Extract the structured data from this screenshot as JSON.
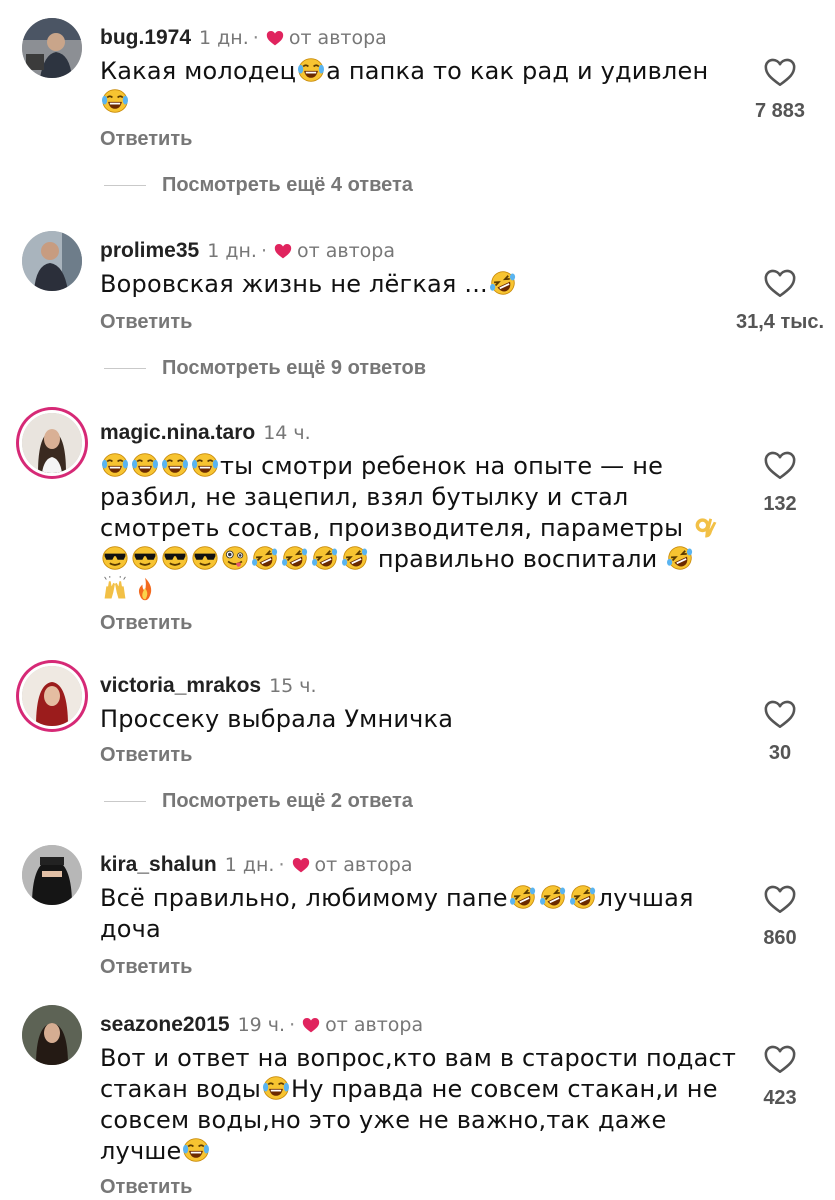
{
  "colors": {
    "heart_author": "#e0245e",
    "text_muted": "#777777",
    "story_ring": "#d62976"
  },
  "comments": [
    {
      "username": "bug.1974",
      "time": "1 дн.",
      "separator": "·",
      "author_liked": true,
      "author_label": "от автора",
      "text_parts": [
        "Какая молодец",
        "a папка то как рад и удивлен",
        ""
      ],
      "reply_label": "Ответить",
      "likes": "7 883",
      "more_replies": "Посмотреть ещё 4 ответа"
    },
    {
      "username": "prolime35",
      "time": "1 дн.",
      "separator": "·",
      "author_liked": true,
      "author_label": "от автора",
      "text_parts": [
        "Воровская жизнь не лёгкая ..."
      ],
      "reply_label": "Ответить",
      "likes": "31,4 тыс.",
      "more_replies": "Посмотреть ещё 9 ответов"
    },
    {
      "username": "magic.nina.taro",
      "time": "14 ч.",
      "text_parts": [
        "ты смотри ребенок на опыте — не разбил, не зацепил, взял бутылку и стал смотреть состав, производителя, параметры",
        "правильно воспитали"
      ],
      "reply_label": "Ответить",
      "likes": "132"
    },
    {
      "username": "victoria_mrakos",
      "time": "15 ч.",
      "text_parts": [
        "Проссеку выбрала Умничка"
      ],
      "reply_label": "Ответить",
      "likes": "30",
      "more_replies": "Посмотреть ещё 2 ответа"
    },
    {
      "username": "kira_shalun",
      "time": "1 дн.",
      "separator": "·",
      "author_liked": true,
      "author_label": "от автора",
      "text_parts": [
        "Всё правильно, любимому папе",
        "лучшая доча"
      ],
      "reply_label": "Ответить",
      "likes": "860"
    },
    {
      "username": "seazone2015",
      "time": "19 ч.",
      "separator": "·",
      "author_liked": true,
      "author_label": "от автора",
      "text_parts": [
        "Вот и ответ на вопрос,кто вам в старости подаст стакан воды",
        "Ну правда не совсем стакан,и не совсем воды,но это уже не важно,так даже лучше"
      ],
      "reply_label": "Ответить",
      "likes": "423"
    }
  ],
  "icons": {
    "like": "heart-outline-icon",
    "author_like": "heart-filled-icon",
    "emoji_laugh_tears": "laughing-tears-emoji",
    "emoji_rofl": "rolling-laughing-emoji",
    "emoji_sunglasses": "sunglasses-emoji",
    "emoji_zany": "zany-face-emoji",
    "emoji_ok": "ok-hand-emoji",
    "emoji_raised_hands": "raised-hands-emoji",
    "emoji_fire": "fire-emoji"
  }
}
